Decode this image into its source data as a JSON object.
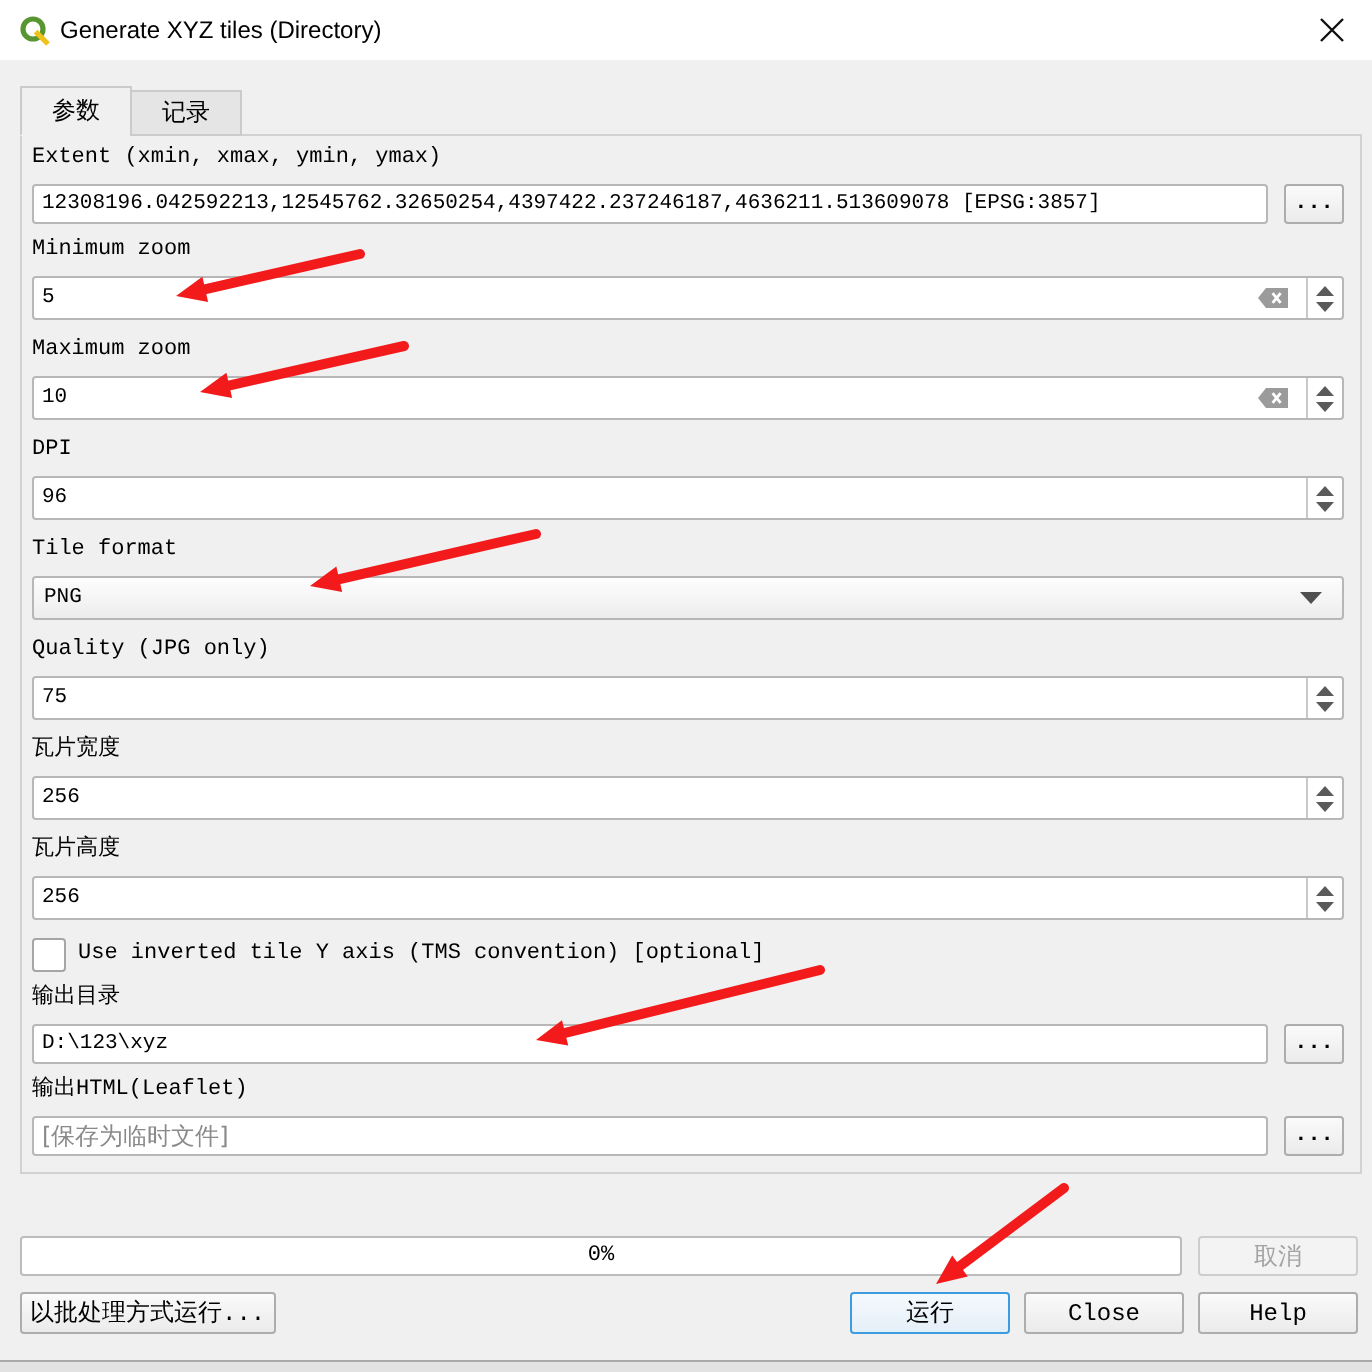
{
  "window": {
    "title": "Generate XYZ tiles (Directory)"
  },
  "tabs": [
    {
      "label": "参数",
      "selected": true
    },
    {
      "label": "记录",
      "selected": false
    }
  ],
  "parameters": [
    {
      "kind": "browse",
      "label": "Extent (xmin, xmax, ymin, ymax)",
      "value": "12308196.042592213,12545762.32650254,4397422.237246187,4636211.513609078 [EPSG:3857]",
      "button_label": "...",
      "arrow": false
    },
    {
      "kind": "spin",
      "label": "Minimum zoom",
      "value": "5",
      "clearable": true,
      "arrow": true
    },
    {
      "kind": "spin",
      "label": "Maximum zoom",
      "value": "10",
      "clearable": true,
      "arrow": true
    },
    {
      "kind": "spin",
      "label": "DPI",
      "value": "96",
      "clearable": false,
      "arrow": false
    },
    {
      "kind": "combo",
      "label": "Tile format",
      "value": "PNG",
      "arrow": true
    },
    {
      "kind": "spin",
      "label": "Quality (JPG only)",
      "value": "75",
      "clearable": false,
      "arrow": false
    },
    {
      "kind": "spin",
      "label": "瓦片宽度",
      "value": "256",
      "clearable": false,
      "arrow": false
    },
    {
      "kind": "spin",
      "label": "瓦片高度",
      "value": "256",
      "clearable": false,
      "arrow": false
    },
    {
      "kind": "checkbox",
      "label": "Use inverted tile Y axis (TMS convention) [optional]",
      "checked": false,
      "arrow": false
    },
    {
      "kind": "browse",
      "label": "输出目录",
      "value": "D:\\123\\xyz",
      "button_label": "...",
      "arrow": true
    },
    {
      "kind": "browse",
      "label": "输出HTML(Leaflet)",
      "placeholder": "[保存为临时文件]",
      "button_label": "...",
      "arrow": false
    }
  ],
  "progress": {
    "level": 0,
    "reading": "0%"
  },
  "cancel_button": {
    "label": "取消",
    "disabled": true
  },
  "batch_button": {
    "label": "以批处理方式运行..."
  },
  "buttons": [
    {
      "label": "运行",
      "default": true,
      "disabled": false,
      "arrow": true
    },
    {
      "label": "Close",
      "default": false,
      "disabled": false,
      "arrow": false
    },
    {
      "label": "Help",
      "default": false,
      "disabled": false,
      "arrow": false
    }
  ]
}
